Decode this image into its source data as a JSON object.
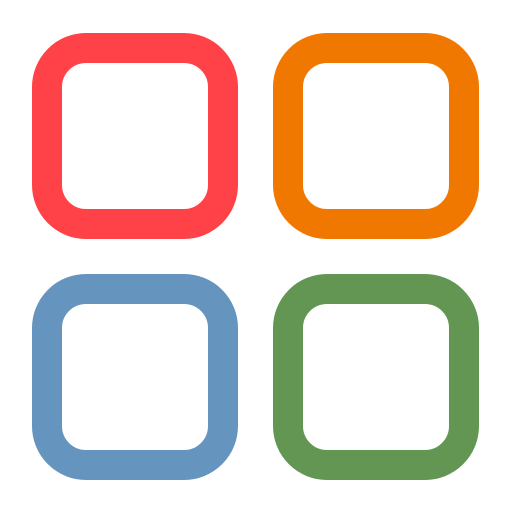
{
  "icon": {
    "name": "app-grid-icon",
    "tiles": [
      {
        "id": "top-left",
        "color": "#ff4248"
      },
      {
        "id": "top-right",
        "color": "#f07800"
      },
      {
        "id": "bottom-left",
        "color": "#6594be"
      },
      {
        "id": "bottom-right",
        "color": "#629652"
      }
    ]
  }
}
